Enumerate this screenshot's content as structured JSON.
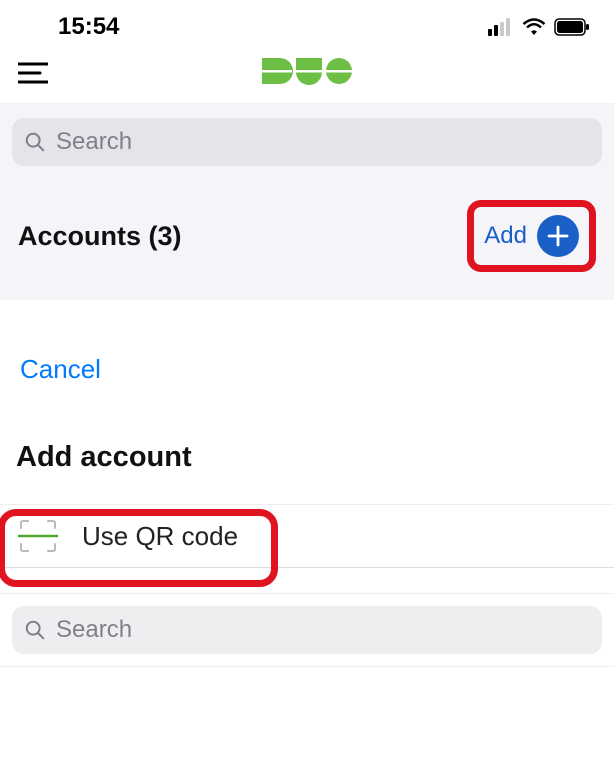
{
  "status": {
    "time": "15:54"
  },
  "search": {
    "placeholder": "Search"
  },
  "accounts": {
    "title": "Accounts (3)",
    "add_label": "Add"
  },
  "sheet": {
    "cancel": "Cancel",
    "title": "Add account",
    "qr_option": "Use QR code",
    "search_placeholder": "Search"
  },
  "colors": {
    "highlight": "#e01420",
    "accent": "#1a5fc6",
    "ios_blue": "#007aff",
    "duo_green": "#6cbe45"
  }
}
